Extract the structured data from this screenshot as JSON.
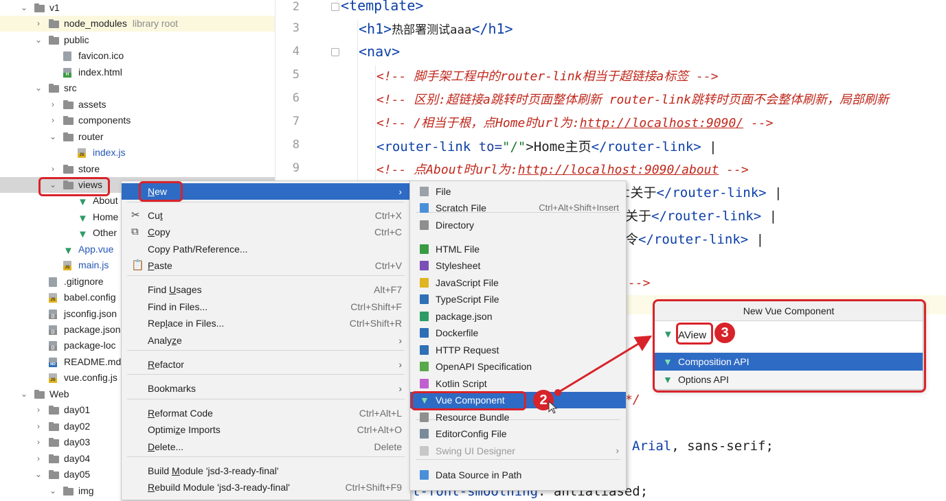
{
  "tree": {
    "items": [
      {
        "label": "v1",
        "kind": "folder",
        "open": true
      },
      {
        "label": "node_modules",
        "suffix": "library root",
        "kind": "folder",
        "open": false
      },
      {
        "label": "public",
        "kind": "folder",
        "open": true
      },
      {
        "label": "favicon.ico",
        "kind": "file"
      },
      {
        "label": "index.html",
        "kind": "html"
      },
      {
        "label": "src",
        "kind": "folder",
        "open": true
      },
      {
        "label": "assets",
        "kind": "folder",
        "open": false
      },
      {
        "label": "components",
        "kind": "folder",
        "open": false
      },
      {
        "label": "router",
        "kind": "folder",
        "open": true
      },
      {
        "label": "index.js",
        "kind": "js"
      },
      {
        "label": "store",
        "kind": "folder",
        "open": false
      },
      {
        "label": "views",
        "kind": "folder",
        "open": true
      },
      {
        "label": "About",
        "kind": "vue"
      },
      {
        "label": "Home",
        "kind": "vue"
      },
      {
        "label": "Other",
        "kind": "vue"
      },
      {
        "label": "App.vue",
        "kind": "vue"
      },
      {
        "label": "main.js",
        "kind": "js"
      },
      {
        "label": ".gitignore",
        "kind": "file"
      },
      {
        "label": "babel.config",
        "kind": "js"
      },
      {
        "label": "jsconfig.json",
        "kind": "cfg"
      },
      {
        "label": "package.json",
        "kind": "cfg"
      },
      {
        "label": "package-loc",
        "kind": "cfg"
      },
      {
        "label": "README.md",
        "kind": "md"
      },
      {
        "label": "vue.config.js",
        "kind": "js"
      },
      {
        "label": "Web",
        "kind": "folder",
        "open": true
      },
      {
        "label": "day01",
        "kind": "folder",
        "open": false
      },
      {
        "label": "day02",
        "kind": "folder",
        "open": false
      },
      {
        "label": "day03",
        "kind": "folder",
        "open": false
      },
      {
        "label": "day04",
        "kind": "folder",
        "open": false
      },
      {
        "label": "day05",
        "kind": "folder",
        "open": true
      },
      {
        "label": "img",
        "kind": "folder",
        "open": true
      }
    ]
  },
  "editor": {
    "line_numbers": [
      "2",
      "3",
      "4",
      "5",
      "6",
      "7",
      "8",
      "9"
    ],
    "l2": "<template>",
    "l3_open": "<h1>",
    "l3_text": "热部署测试aaa",
    "l3_close": "</h1>",
    "l4": "<nav>",
    "l5": "<!-- 脚手架工程中的router-link相当于超链接a标签 -->",
    "l6": "<!-- 区别:超链接a跳转时页面整体刷新 router-link跳转时页面不会整体刷新，局部刷新",
    "l7_pre": "<!-- /相当于根，点Home时url为:",
    "l7_url": "http://localhost:9090/",
    "l7_post": " -->",
    "l8_open": "<router-link",
    "l8_attr": " to=",
    "l8_val": "\"/\"",
    "l8_text": ">Home主页",
    "l8_close": "</router-link>",
    "l8_pipe": " |",
    "l9_pre": "<!-- 点About时url为:",
    "l9_url": "http://localhost:9090/about",
    "l9_post": " -->",
    "r1_text": "t关于",
    "r1_close": "</router-link>",
    "r1_pipe": " |",
    "r2_text": "关于",
    "r2_close": "</router-link>",
    "r2_pipe": " |",
    "r3_text": "令",
    "r3_close": "</router-link>",
    "r3_pipe": " |",
    "r4": "-->",
    "r5": "*/",
    "r6_font": "Arial",
    "r6_rest": ", sans-serif;",
    "r7_prop": "t-font-smoothing",
    "r7_val": ": antialiased;"
  },
  "context_menu": {
    "items": [
      {
        "label": "New",
        "arrow": "›"
      },
      {
        "label": "Cut",
        "shortcut": "Ctrl+X",
        "icon": "✂"
      },
      {
        "label": "Copy",
        "shortcut": "Ctrl+C",
        "icon": "⧉"
      },
      {
        "label": "Copy Path/Reference..."
      },
      {
        "label": "Paste",
        "shortcut": "Ctrl+V",
        "icon": "📋"
      },
      {
        "label": "Find Usages",
        "shortcut": "Alt+F7"
      },
      {
        "label": "Find in Files...",
        "shortcut": "Ctrl+Shift+F"
      },
      {
        "label": "Replace in Files...",
        "shortcut": "Ctrl+Shift+R"
      },
      {
        "label": "Analyze",
        "arrow": "›"
      },
      {
        "label": "Refactor",
        "arrow": "›"
      },
      {
        "label": "Bookmarks",
        "arrow": "›"
      },
      {
        "label": "Reformat Code",
        "shortcut": "Ctrl+Alt+L"
      },
      {
        "label": "Optimize Imports",
        "shortcut": "Ctrl+Alt+O"
      },
      {
        "label": "Delete...",
        "shortcut": "Delete"
      },
      {
        "label": "Build Module 'jsd-3-ready-final'"
      },
      {
        "label": "Rebuild Module 'jsd-3-ready-final'",
        "shortcut": "Ctrl+Shift+F9"
      }
    ]
  },
  "submenu": {
    "items": [
      {
        "label": "File"
      },
      {
        "label": "Scratch File",
        "shortcut": "Ctrl+Alt+Shift+Insert"
      },
      {
        "label": "Directory"
      },
      {
        "label": "HTML File"
      },
      {
        "label": "Stylesheet"
      },
      {
        "label": "JavaScript File"
      },
      {
        "label": "TypeScript File"
      },
      {
        "label": "package.json"
      },
      {
        "label": "Dockerfile"
      },
      {
        "label": "HTTP Request"
      },
      {
        "label": "OpenAPI Specification"
      },
      {
        "label": "Kotlin Script"
      },
      {
        "label": "Vue Component"
      },
      {
        "label": "Resource Bundle"
      },
      {
        "label": "EditorConfig File"
      },
      {
        "label": "Swing UI Designer",
        "arrow": "›"
      },
      {
        "label": "Data Source in Path"
      }
    ]
  },
  "dialog": {
    "title": "New Vue Component",
    "input_value": "AView",
    "options": [
      "Composition API",
      "Options API"
    ]
  },
  "badges": [
    "2",
    "3"
  ],
  "colors": {
    "accent": "#2e6bc4",
    "annotation": "#d8232a",
    "vue": "#2e9b66"
  }
}
